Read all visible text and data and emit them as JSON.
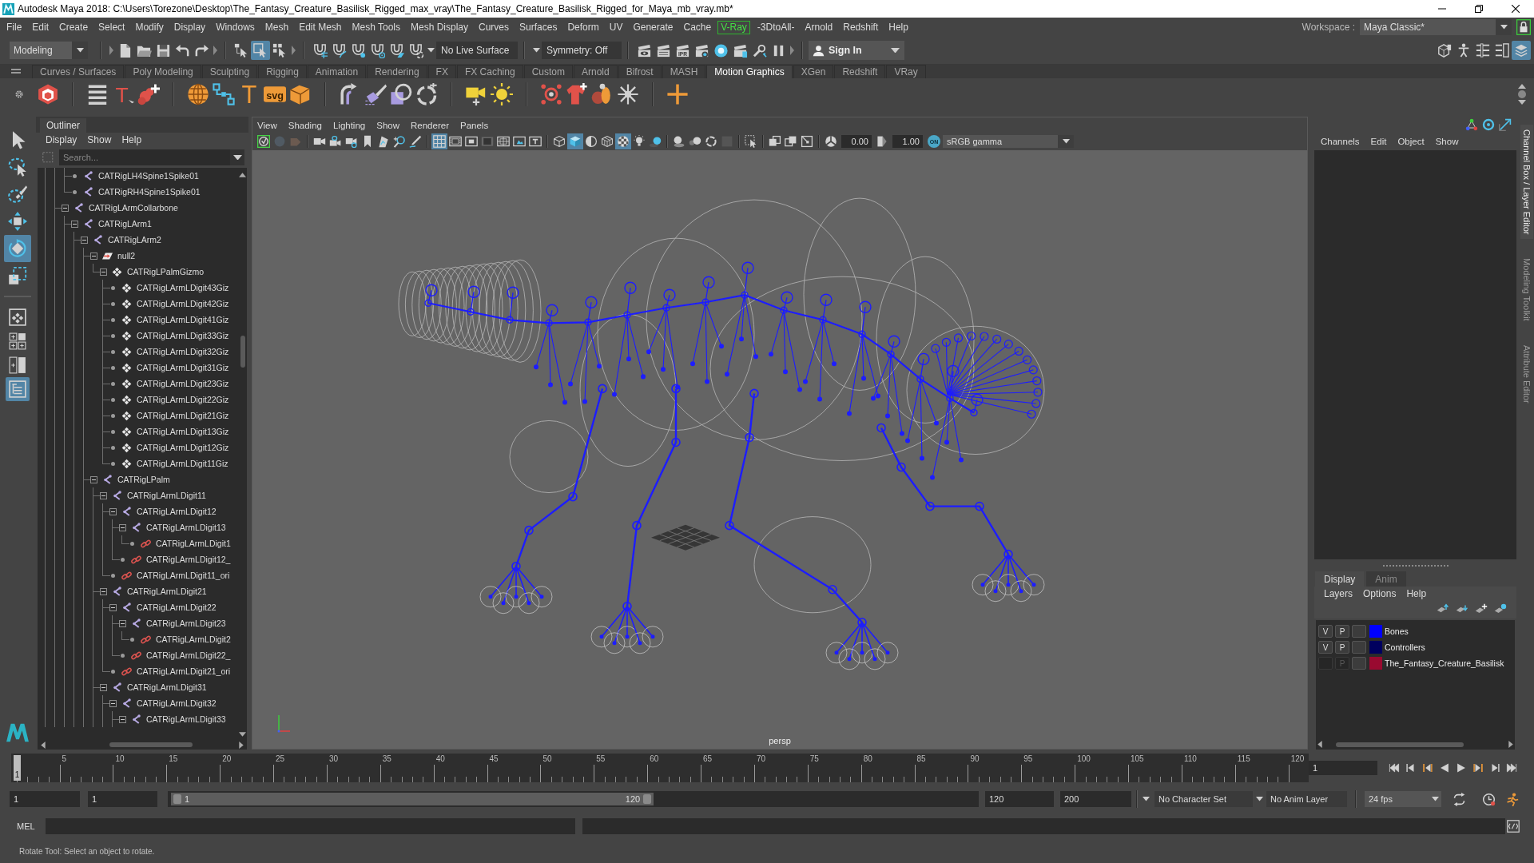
{
  "window": {
    "title": "Autodesk Maya 2018: C:\\Users\\Torezone\\Desktop\\The_Fantasy_Creature_Basilisk_Rigged_max_vray\\The_Fantasy_Creature_Basilisk_Rigged_for_Maya_mb_vray.mb*"
  },
  "menu_bar": {
    "items": [
      {
        "label": "File",
        "kind": "menu"
      },
      {
        "label": "Edit",
        "kind": "menu"
      },
      {
        "label": "Create",
        "kind": "menu"
      },
      {
        "label": "Select",
        "kind": "menu"
      },
      {
        "label": "Modify",
        "kind": "menu"
      },
      {
        "label": "Display",
        "kind": "menu"
      },
      {
        "label": "Windows",
        "kind": "menu"
      },
      {
        "label": "Mesh",
        "kind": "menu"
      },
      {
        "label": "Edit Mesh",
        "kind": "menu"
      },
      {
        "label": "Mesh Tools",
        "kind": "menu"
      },
      {
        "label": "Mesh Display",
        "kind": "menu"
      },
      {
        "label": "Curves",
        "kind": "menu"
      },
      {
        "label": "Surfaces",
        "kind": "menu"
      },
      {
        "label": "Deform",
        "kind": "menu"
      },
      {
        "label": "UV",
        "kind": "menu"
      },
      {
        "label": "Generate",
        "kind": "menu"
      },
      {
        "label": "Cache",
        "kind": "menu"
      },
      {
        "label": "V-Ray",
        "kind": "plugin"
      },
      {
        "label": "-3DtoAll-",
        "kind": "menu"
      },
      {
        "label": "Arnold",
        "kind": "menu"
      },
      {
        "label": "Redshift",
        "kind": "menu"
      },
      {
        "label": "Help",
        "kind": "menu"
      }
    ],
    "workspace_label": "Workspace :",
    "workspace": "Maya Classic*"
  },
  "status_line": {
    "mode": "Modeling",
    "selection_modes": [
      {
        "kind": "hierarchy",
        "selected": false
      },
      {
        "kind": "object",
        "selected": true
      },
      {
        "kind": "component",
        "selected": false
      }
    ],
    "live_surface": "No Live Surface",
    "symmetry": "Symmetry: Off",
    "ipr_label": "IPR",
    "sign_in": "Sign In",
    "panel_toggles": [
      {
        "kind": "modeling_toolkit",
        "selected": false
      },
      {
        "kind": "human_ik",
        "selected": false
      },
      {
        "kind": "attribute_editor",
        "selected": false
      },
      {
        "kind": "tool_settings",
        "selected": false
      },
      {
        "kind": "channel_box",
        "selected": true
      }
    ]
  },
  "shelf": {
    "tabs": [
      {
        "label": "Curves / Surfaces",
        "selected": false
      },
      {
        "label": "Poly Modeling",
        "selected": false
      },
      {
        "label": "Sculpting",
        "selected": false
      },
      {
        "label": "Rigging",
        "selected": false
      },
      {
        "label": "Animation",
        "selected": false
      },
      {
        "label": "Rendering",
        "selected": false
      },
      {
        "label": "FX",
        "selected": false
      },
      {
        "label": "FX Caching",
        "selected": false
      },
      {
        "label": "Custom",
        "selected": false
      },
      {
        "label": "Arnold",
        "selected": false
      },
      {
        "label": "Bifrost",
        "selected": false
      },
      {
        "label": "MASH",
        "selected": false
      },
      {
        "label": "Motion Graphics",
        "selected": true
      },
      {
        "label": "XGen",
        "selected": false
      },
      {
        "label": "Redshift",
        "selected": false
      },
      {
        "label": "VRay",
        "selected": false
      }
    ],
    "tools": [
      {
        "kind": "mash_network"
      },
      {
        "kind": "separator"
      },
      {
        "kind": "list"
      },
      {
        "kind": "text_tool",
        "label": "T"
      },
      {
        "kind": "spray"
      },
      {
        "kind": "separator"
      },
      {
        "kind": "globe"
      },
      {
        "kind": "nodes"
      },
      {
        "kind": "type",
        "label": "T"
      },
      {
        "kind": "svg",
        "label": "svg"
      },
      {
        "kind": "box"
      },
      {
        "kind": "separator"
      },
      {
        "kind": "curve_warp"
      },
      {
        "kind": "brush"
      },
      {
        "kind": "shapes"
      },
      {
        "kind": "ring"
      },
      {
        "kind": "separator"
      },
      {
        "kind": "camera"
      },
      {
        "kind": "sun"
      },
      {
        "kind": "separator"
      },
      {
        "kind": "burst"
      },
      {
        "kind": "shirt"
      },
      {
        "kind": "bowling"
      },
      {
        "kind": "explode"
      },
      {
        "kind": "separator"
      },
      {
        "kind": "cross"
      }
    ]
  },
  "toolbox": {
    "tools": [
      {
        "kind": "select",
        "selected": false
      },
      {
        "kind": "lasso",
        "selected": false
      },
      {
        "kind": "paint_select",
        "selected": false
      },
      {
        "kind": "move",
        "selected": false
      },
      {
        "kind": "rotate",
        "selected": true
      },
      {
        "kind": "scale",
        "selected": false
      }
    ],
    "layouts": [
      {
        "kind": "single",
        "selected": false
      },
      {
        "kind": "four",
        "selected": false
      },
      {
        "kind": "two",
        "selected": false
      },
      {
        "kind": "outliner",
        "selected": true
      }
    ]
  },
  "outliner": {
    "title": "Outliner",
    "menus": [
      "Display",
      "Show",
      "Help"
    ],
    "search": {
      "placeholder": "Search..."
    },
    "tree": [
      {
        "children": [
          {
            "children": [
              {
                "children": [
                  {
                    "label": "CATRigLH4Spine1Spike01",
                    "kind": "joint"
                  },
                  {
                    "label": "CATRigRH4Spine1Spike01",
                    "kind": "joint"
                  }
                ]
              },
              {
                "label": "CATRigLArmCollarbone",
                "kind": "joint",
                "expanded": true,
                "children": [
                  {
                    "label": "CATRigLArm1",
                    "kind": "joint",
                    "expanded": true,
                    "children": [
                      {
                        "label": "CATRigLArm2",
                        "kind": "joint",
                        "expanded": true,
                        "children": [
                          {
                            "label": "null2",
                            "kind": "locator",
                            "expanded": true,
                            "children": [
                              {
                                "label": "CATRigLPalmGizmo",
                                "kind": "gizmo",
                                "expanded": true,
                                "children": [
                                  {
                                    "label": "CATRigLArmLDigit43Giz",
                                    "kind": "gizmo"
                                  },
                                  {
                                    "label": "CATRigLArmLDigit42Giz",
                                    "kind": "gizmo"
                                  },
                                  {
                                    "label": "CATRigLArmLDigit41Giz",
                                    "kind": "gizmo"
                                  },
                                  {
                                    "label": "CATRigLArmLDigit33Giz",
                                    "kind": "gizmo"
                                  },
                                  {
                                    "label": "CATRigLArmLDigit32Giz",
                                    "kind": "gizmo"
                                  },
                                  {
                                    "label": "CATRigLArmLDigit31Giz",
                                    "kind": "gizmo"
                                  },
                                  {
                                    "label": "CATRigLArmLDigit23Giz",
                                    "kind": "gizmo"
                                  },
                                  {
                                    "label": "CATRigLArmLDigit22Giz",
                                    "kind": "gizmo"
                                  },
                                  {
                                    "label": "CATRigLArmLDigit21Giz",
                                    "kind": "gizmo"
                                  },
                                  {
                                    "label": "CATRigLArmLDigit13Giz",
                                    "kind": "gizmo"
                                  },
                                  {
                                    "label": "CATRigLArmLDigit12Giz",
                                    "kind": "gizmo"
                                  },
                                  {
                                    "label": "CATRigLArmLDigit11Giz",
                                    "kind": "gizmo"
                                  }
                                ]
                              }
                            ]
                          },
                          {
                            "label": "CATRigLPalm",
                            "kind": "joint",
                            "expanded": true,
                            "children": [
                              {
                                "label": "CATRigLArmLDigit11",
                                "kind": "joint",
                                "expanded": true,
                                "children": [
                                  {
                                    "label": "CATRigLArmLDigit12",
                                    "kind": "joint",
                                    "expanded": true,
                                    "children": [
                                      {
                                        "label": "CATRigLArmLDigit13",
                                        "kind": "joint",
                                        "expanded": true,
                                        "children": [
                                          {
                                            "label": "CATRigLArmLDigit1",
                                            "kind": "constraint"
                                          }
                                        ]
                                      },
                                      {
                                        "label": "CATRigLArmLDigit12_",
                                        "kind": "constraint"
                                      }
                                    ]
                                  },
                                  {
                                    "label": "CATRigLArmLDigit11_ori",
                                    "kind": "constraint"
                                  }
                                ]
                              },
                              {
                                "label": "CATRigLArmLDigit21",
                                "kind": "joint",
                                "expanded": true,
                                "children": [
                                  {
                                    "label": "CATRigLArmLDigit22",
                                    "kind": "joint",
                                    "expanded": true,
                                    "children": [
                                      {
                                        "label": "CATRigLArmLDigit23",
                                        "kind": "joint",
                                        "expanded": true,
                                        "children": [
                                          {
                                            "label": "CATRigLArmLDigit2",
                                            "kind": "constraint"
                                          }
                                        ]
                                      },
                                      {
                                        "label": "CATRigLArmLDigit22_",
                                        "kind": "constraint"
                                      }
                                    ]
                                  },
                                  {
                                    "label": "CATRigLArmLDigit21_ori",
                                    "kind": "constraint"
                                  }
                                ]
                              },
                              {
                                "label": "CATRigLArmLDigit31",
                                "kind": "joint",
                                "expanded": true,
                                "children": [
                                  {
                                    "label": "CATRigLArmLDigit32",
                                    "kind": "joint",
                                    "expanded": true,
                                    "children": [
                                      {
                                        "label": "CATRigLArmLDigit33",
                                        "kind": "joint",
                                        "expanded": true
                                      }
                                    ]
                                  }
                                ]
                              }
                            ]
                          }
                        ]
                      }
                    ]
                  }
                ]
              }
            ]
          }
        ]
      }
    ]
  },
  "viewport": {
    "menus": [
      "View",
      "Shading",
      "Lighting",
      "Show",
      "Renderer",
      "Panels"
    ],
    "toolbar": [
      {
        "kind": "renderer",
        "selected": false
      },
      {
        "kind": "dim_sphere",
        "selected": false
      },
      {
        "kind": "dim_camera",
        "selected": false
      },
      {
        "kind": "separator"
      },
      {
        "kind": "camera",
        "selected": false
      },
      {
        "kind": "camera_lock",
        "selected": false
      },
      {
        "kind": "camera_attributes",
        "selected": false
      },
      {
        "kind": "bookmark",
        "selected": false
      },
      {
        "kind": "image_plane",
        "selected": false
      },
      {
        "kind": "pan_zoom",
        "selected": false
      },
      {
        "kind": "grease_pencil",
        "selected": false
      },
      {
        "kind": "separator"
      },
      {
        "kind": "grid",
        "selected": true
      },
      {
        "kind": "film_gate",
        "selected": false
      },
      {
        "kind": "resolution_gate",
        "selected": false
      },
      {
        "kind": "gate_mask",
        "selected": false
      },
      {
        "kind": "field_chart",
        "selected": false
      },
      {
        "kind": "safe_action",
        "selected": false
      },
      {
        "kind": "safe_title",
        "selected": false
      },
      {
        "kind": "separator"
      },
      {
        "kind": "wireframe",
        "selected": false
      },
      {
        "kind": "smooth_shade",
        "selected": true
      },
      {
        "kind": "wire_on_shaded",
        "selected": false
      },
      {
        "kind": "default_material",
        "selected": false
      },
      {
        "kind": "textured",
        "selected": true
      },
      {
        "kind": "lights",
        "selected": false
      },
      {
        "kind": "shadows",
        "selected": false
      },
      {
        "kind": "separator"
      },
      {
        "kind": "ambient_occlusion",
        "selected": false
      },
      {
        "kind": "motion_blur",
        "selected": false
      },
      {
        "kind": "anti_aliasing",
        "selected": false
      },
      {
        "kind": "depth_of_field",
        "selected": false
      },
      {
        "kind": "separator"
      },
      {
        "kind": "isolate_select",
        "selected": false
      },
      {
        "kind": "separator"
      },
      {
        "kind": "xray",
        "selected": false
      },
      {
        "kind": "xray_joints",
        "selected": false
      },
      {
        "kind": "xray_components",
        "selected": false
      },
      {
        "kind": "separator"
      }
    ],
    "exposure": "0.00",
    "gamma": "1.00",
    "color_management": "ON",
    "color_space": "sRGB gamma",
    "camera": "persp"
  },
  "channel_box": {
    "menus": [
      "Channels",
      "Edit",
      "Object",
      "Show"
    ]
  },
  "layer_editor": {
    "tabs": [
      {
        "label": "Display",
        "selected": true
      },
      {
        "label": "Anim",
        "selected": false
      }
    ],
    "menus": [
      "Layers",
      "Options",
      "Help"
    ],
    "layers": [
      {
        "visibility_label": "V",
        "visible": true,
        "playback_label": "P",
        "playback": true,
        "color": "#0000ff",
        "name": "Bones"
      },
      {
        "visibility_label": "V",
        "visible": true,
        "playback_label": "P",
        "playback": true,
        "color": "#00005e",
        "name": "Controllers"
      },
      {
        "visible": false,
        "playback_label": "P",
        "playback": false,
        "color": "#990a30",
        "name": "The_Fantasy_Creature_Basilisk"
      }
    ]
  },
  "side_tabs": [
    {
      "label": "Channel Box / Layer Editor",
      "selected": true
    },
    {
      "label": "Modeling Toolkit",
      "selected": false
    },
    {
      "label": "Attribute Editor",
      "selected": false
    }
  ],
  "time_slider": {
    "current_marker": "1",
    "level": 0,
    "tick_labels": [
      "5",
      "10",
      "15",
      "20",
      "25",
      "30",
      "35",
      "40",
      "45",
      "50",
      "55",
      "60",
      "65",
      "70",
      "75",
      "80",
      "85",
      "90",
      "95",
      "100",
      "105",
      "110",
      "115",
      "120"
    ],
    "current_frame": "1"
  },
  "range_slider": {
    "start_time": "1",
    "playback_start": "1",
    "range_start": "1",
    "range_end": "120",
    "level": 0.6,
    "playback_end": "120",
    "end_time": "200",
    "character_set": "No Character Set",
    "anim_layer": "No Anim Layer",
    "fps": "24 fps"
  },
  "command_line": {
    "language": "MEL"
  },
  "help_line": {
    "text": "Rotate Tool: Select an object to rotate."
  }
}
